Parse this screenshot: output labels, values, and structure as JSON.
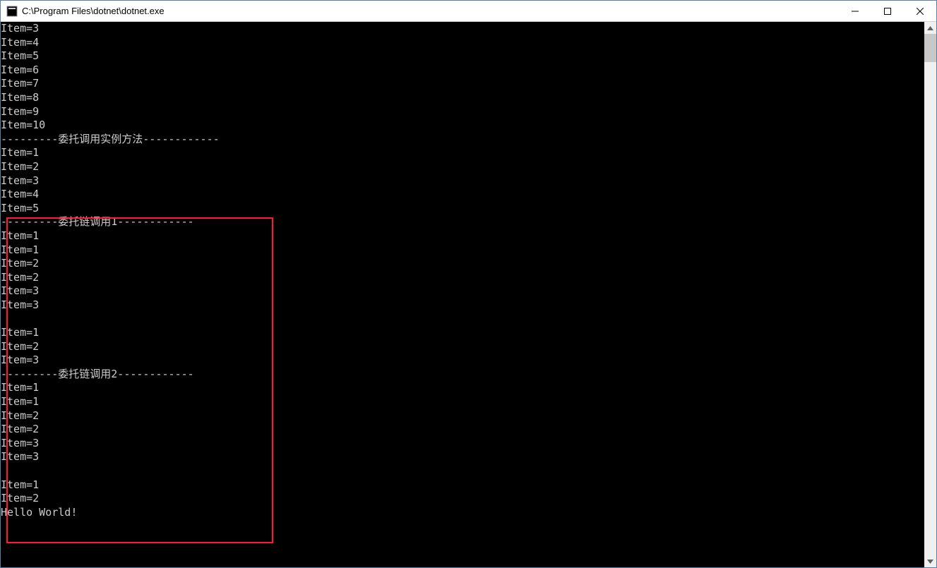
{
  "window": {
    "title": "C:\\Program Files\\dotnet\\dotnet.exe"
  },
  "console": {
    "lines": [
      "Item=3",
      "Item=4",
      "Item=5",
      "Item=6",
      "Item=7",
      "Item=8",
      "Item=9",
      "Item=10",
      "---------委托调用实例方法------------",
      "Item=1",
      "Item=2",
      "Item=3",
      "Item=4",
      "Item=5",
      "---------委托链调用1------------",
      "Item=1",
      "Item=1",
      "Item=2",
      "Item=2",
      "Item=3",
      "Item=3",
      "",
      "Item=1",
      "Item=2",
      "Item=3",
      "---------委托链调用2------------",
      "Item=1",
      "Item=1",
      "Item=2",
      "Item=2",
      "Item=3",
      "Item=3",
      "",
      "Item=1",
      "Item=2",
      "Hello World!"
    ]
  }
}
